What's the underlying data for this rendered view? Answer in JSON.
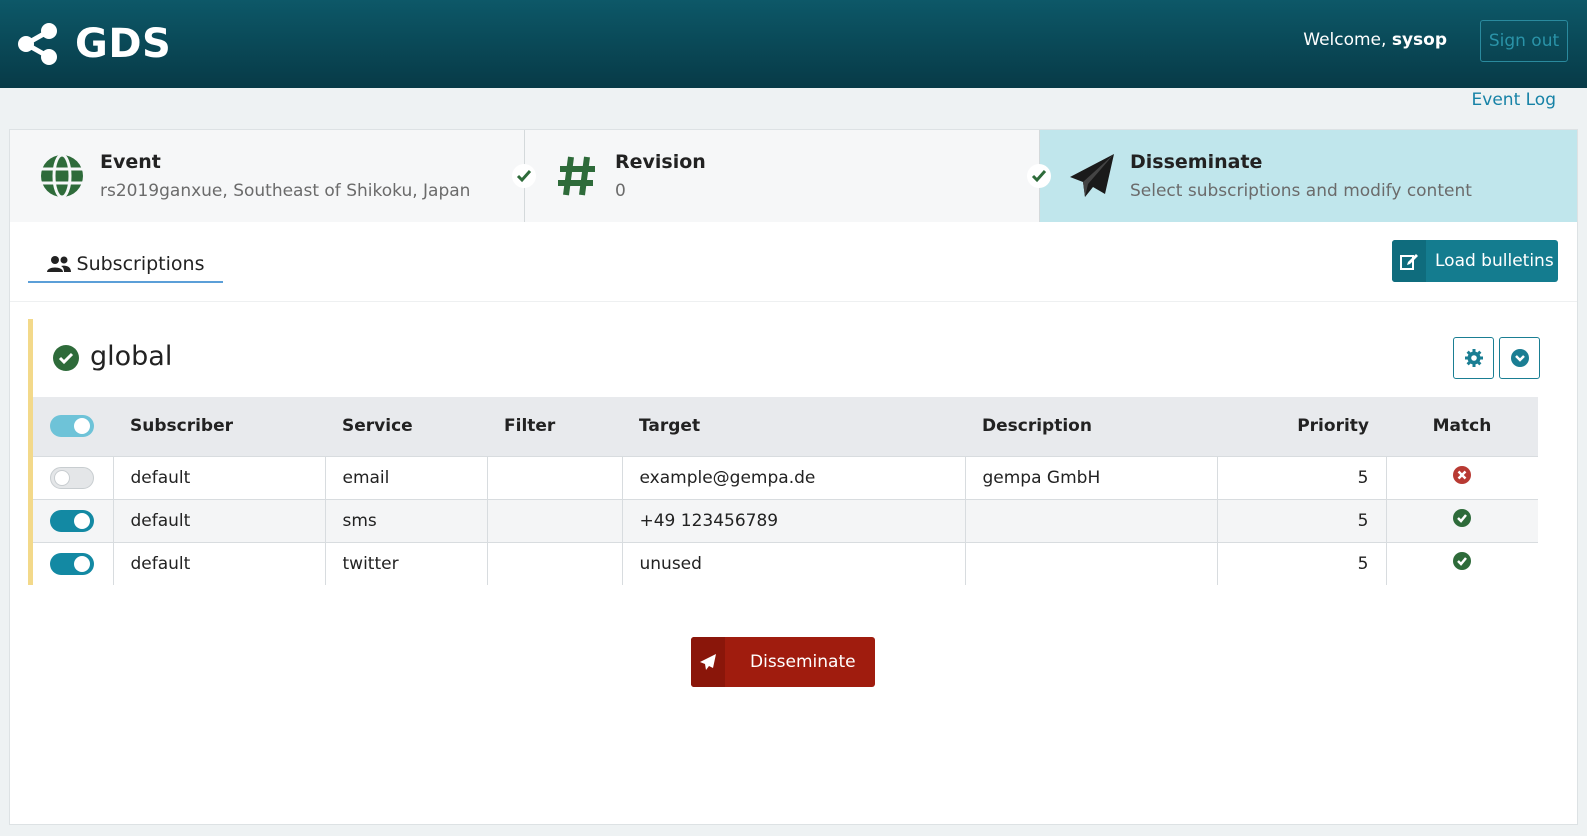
{
  "app": {
    "name": "GDS"
  },
  "user": {
    "welcome_prefix": "Welcome,",
    "username": "sysop",
    "signout_label": "Sign out"
  },
  "nav": {
    "event_log_label": "Event Log"
  },
  "steps": [
    {
      "title": "Event",
      "subtitle": "rs2019ganxue, Southeast of Shikoku, Japan",
      "icon": "globe-icon"
    },
    {
      "title": "Revision",
      "subtitle": "0",
      "icon": "hash-icon"
    },
    {
      "title": "Disseminate",
      "subtitle": "Select subscriptions and modify content",
      "icon": "paper-plane-icon"
    }
  ],
  "tabs": {
    "subscriptions_label": "Subscriptions"
  },
  "toolbar": {
    "load_bulletins_label": "Load bulletins"
  },
  "group": {
    "name": "global",
    "columns": [
      "Subscriber",
      "Service",
      "Filter",
      "Target",
      "Description",
      "Priority",
      "Match"
    ],
    "rows": [
      {
        "enabled": false,
        "subscriber": "default",
        "service": "email",
        "filter": "",
        "target": "example@gempa.de",
        "description": "gempa GmbH",
        "priority": "5",
        "match": false
      },
      {
        "enabled": true,
        "subscriber": "default",
        "service": "sms",
        "filter": "",
        "target": "+49 123456789",
        "description": "",
        "priority": "5",
        "match": true
      },
      {
        "enabled": true,
        "subscriber": "default",
        "service": "twitter",
        "filter": "",
        "target": "unused",
        "description": "",
        "priority": "5",
        "match": true
      }
    ]
  },
  "actions": {
    "disseminate_label": "Disseminate"
  },
  "colors": {
    "header": "#0b4c5a",
    "accent": "#147c8f",
    "danger": "#a01c0e",
    "success": "#2e6b3a",
    "error": "#b83a33"
  }
}
